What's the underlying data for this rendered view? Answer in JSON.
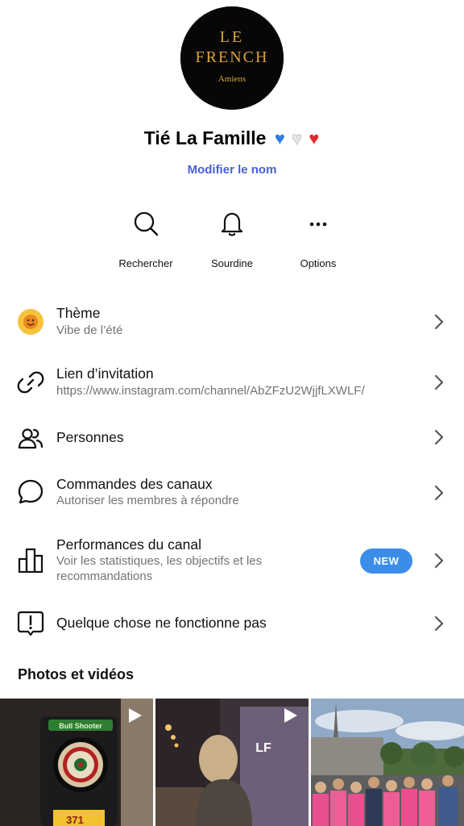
{
  "profile": {
    "logo_line1": "LE",
    "logo_line2": "FRENCH",
    "logo_line3": "Amiens",
    "name": "Tié La Famille",
    "emojis": {
      "blue": "♥",
      "white": "♥",
      "red": "♥"
    },
    "edit_name_label": "Modifier le nom"
  },
  "actions": [
    {
      "label": "Rechercher",
      "icon": "search-icon"
    },
    {
      "label": "Sourdine",
      "icon": "bell-icon"
    },
    {
      "label": "Options",
      "icon": "more-icon"
    }
  ],
  "menu": {
    "theme": {
      "title": "Thème",
      "subtitle": "Vibe de l’été"
    },
    "invite": {
      "title": "Lien d’invitation",
      "subtitle": "https://www.instagram.com/channel/AbZFzU2WjjfLXWLF/"
    },
    "people": {
      "title": "Personnes"
    },
    "commands": {
      "title": "Commandes des canaux",
      "subtitle": "Autoriser les membres à répondre"
    },
    "performance": {
      "title": "Performances du canal",
      "subtitle_line1": "Voir les statistiques, les objectifs et les",
      "subtitle_line2": "recommandations",
      "badge": "NEW"
    },
    "report": {
      "title": "Quelque chose ne fonctionne pas"
    }
  },
  "media": {
    "section_title": "Photos et vidéos",
    "items": [
      {
        "type": "video",
        "overlay_text": "Bull Shooter",
        "score": "371"
      },
      {
        "type": "video",
        "overlay_text": "LF"
      },
      {
        "type": "photo"
      }
    ]
  },
  "colors": {
    "accent_link": "#4a5fd9",
    "badge": "#3b8de9",
    "subtitle_gray": "#737373",
    "logo_gold": "#d9a23f"
  }
}
